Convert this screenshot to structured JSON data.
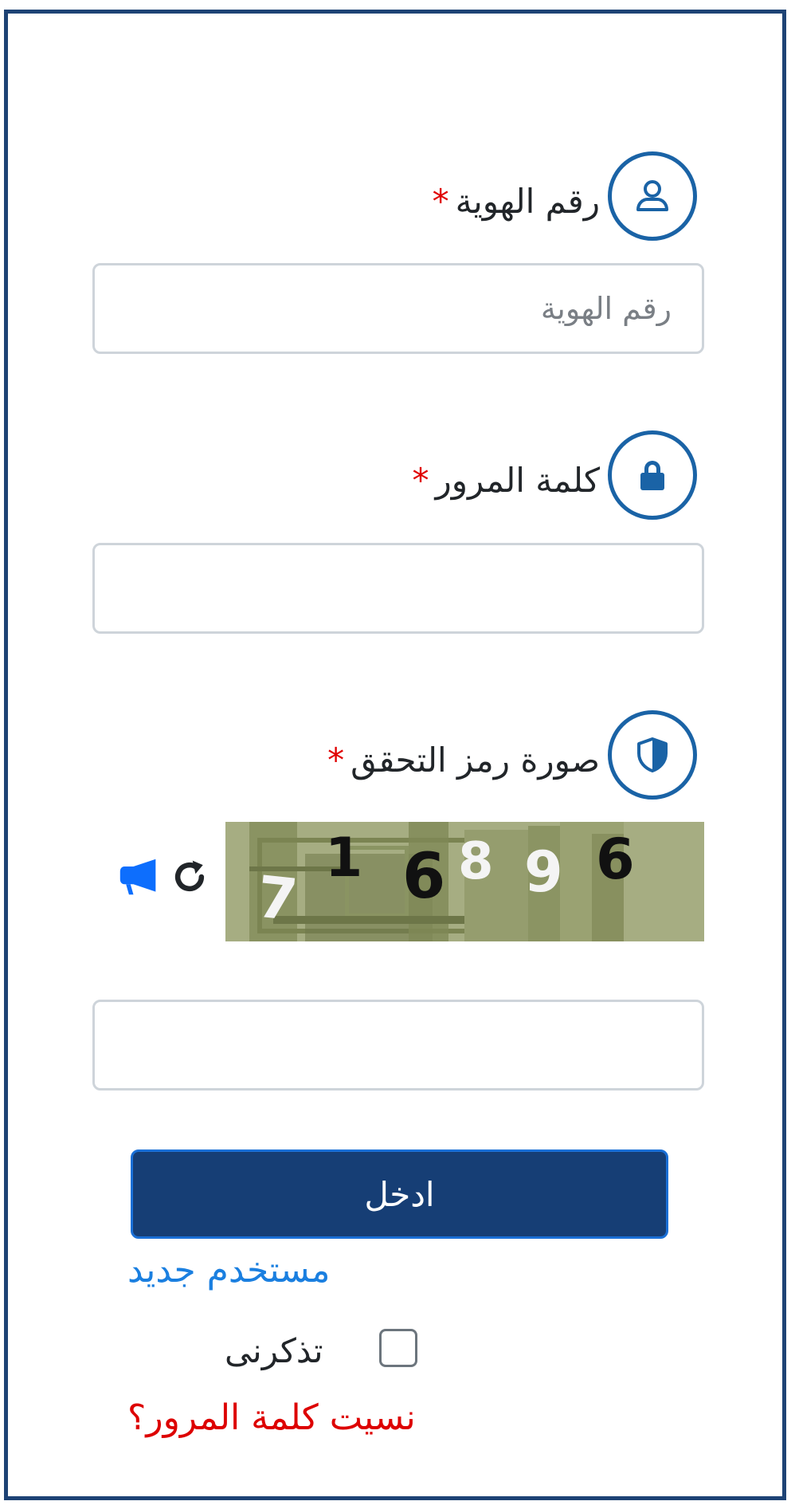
{
  "form": {
    "id_field": {
      "label": "رقم الهوية",
      "required_mark": "*",
      "placeholder": "رقم الهوية",
      "icon": "user-icon"
    },
    "password_field": {
      "label": "كلمة المرور",
      "required_mark": "*",
      "placeholder": "",
      "icon": "lock-icon"
    },
    "captcha_field": {
      "label": "صورة رمز التحقق",
      "required_mark": "*",
      "placeholder": "",
      "icon": "shield-icon",
      "captcha_digits": [
        "7",
        "1",
        "6",
        "8",
        "9",
        "6"
      ],
      "refresh_icon": "refresh-icon",
      "audio_icon": "megaphone-icon"
    },
    "submit_label": "ادخل",
    "new_user_link": "مستخدم جديد",
    "remember_me_label": "تذكرنى",
    "remember_me_checked": false,
    "forgot_password_link": "نسيت كلمة المرور؟"
  },
  "colors": {
    "frame_border": "#1e4375",
    "icon_accent": "#1a63a6",
    "submit_bg": "#163e75",
    "link_blue": "#1a7fe0",
    "link_red": "#dd0000",
    "required": "#e00000",
    "captcha_bg": "#a6ad82"
  }
}
